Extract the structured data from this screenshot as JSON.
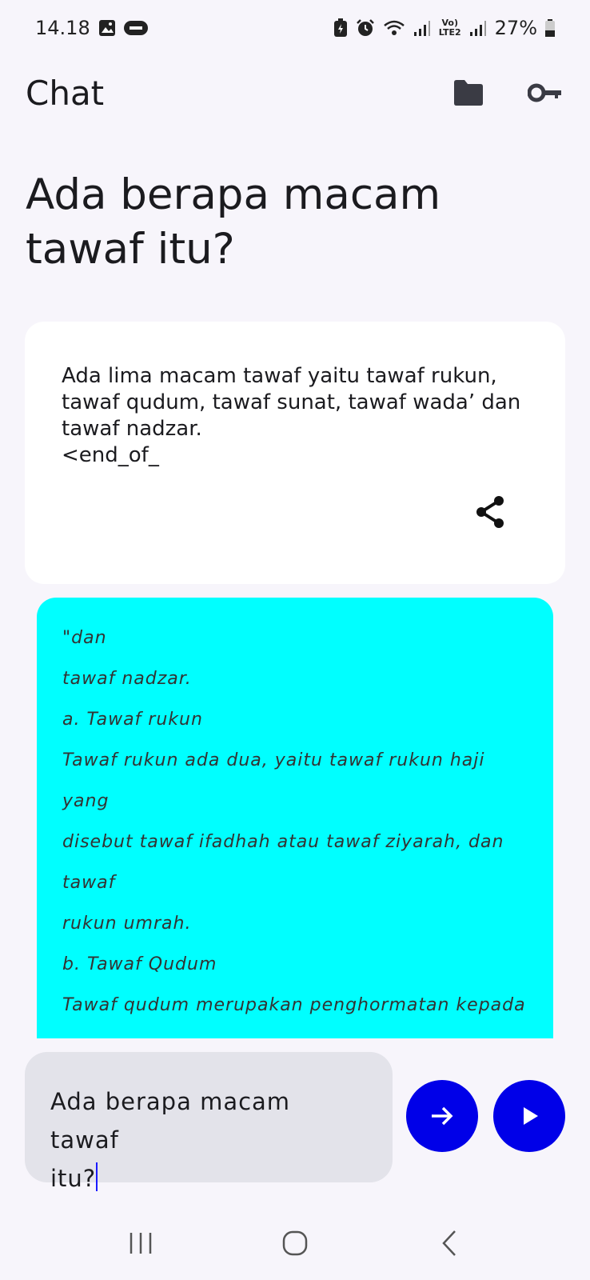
{
  "status_bar": {
    "time": "14.18",
    "battery": "27%",
    "network_label_top": "Vo)",
    "network_label_bottom": "LTE2",
    "icons": [
      "image-icon",
      "axis-icon",
      "battery-saver-icon",
      "alarm-icon",
      "wifi-icon",
      "signal-icon",
      "battery-icon"
    ]
  },
  "app_bar": {
    "title": "Chat",
    "icons": [
      "folder-icon",
      "key-icon"
    ]
  },
  "question": {
    "text": "Ada berapa macam tawaf itu?"
  },
  "answer": {
    "text": "Ada lima macam tawaf yaitu tawaf rukun,\ntawaf qudum, tawaf sunat, tawaf wada’ dan\ntawaf nadzar.\n<end_of_",
    "share_icon": "share-icon"
  },
  "source": {
    "background": "#00ffff",
    "lines": [
      "\"dan",
      "tawaf nadzar.",
      "a. Tawaf rukun",
      "Tawaf rukun ada dua, yaitu tawaf rukun haji",
      "yang",
      "disebut tawaf ifadhah atau tawaf ziyarah, dan",
      "tawaf",
      "rukun umrah.",
      "b. Tawaf Qudum",
      "Tawaf qudum merupakan penghormatan kepada"
    ]
  },
  "input": {
    "value": "Ada berapa macam tawaf\nitu?"
  },
  "buttons": {
    "send_icon": "arrow-right-icon",
    "play_icon": "play-icon",
    "color": "#0000e8"
  },
  "nav_bar": {
    "icons": [
      "recents-icon",
      "home-icon",
      "back-icon"
    ]
  }
}
